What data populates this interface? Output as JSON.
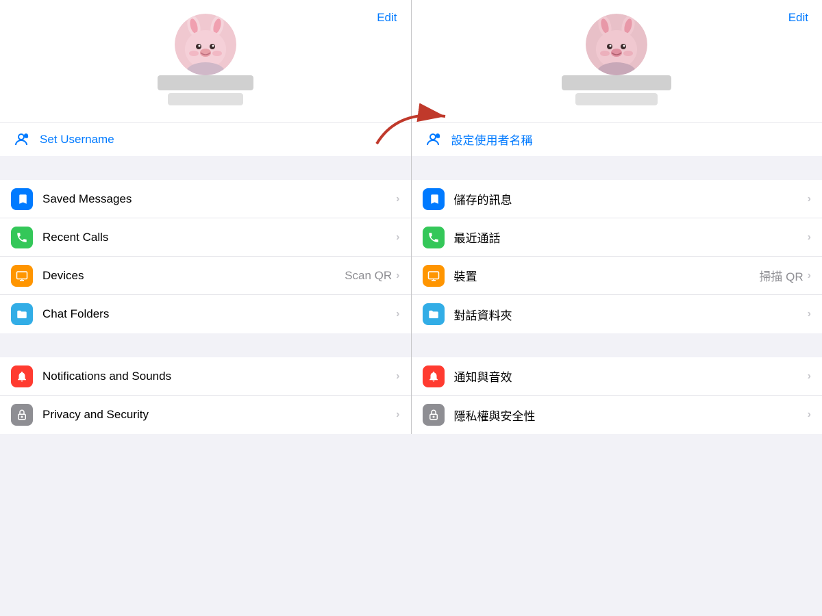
{
  "left": {
    "edit_label": "Edit",
    "username_label": "Set Username",
    "menu_groups": [
      {
        "items": [
          {
            "id": "saved-messages",
            "label": "Saved Messages",
            "icon": "bookmark",
            "icon_color": "icon-blue"
          },
          {
            "id": "recent-calls",
            "label": "Recent Calls",
            "icon": "phone",
            "icon_color": "icon-green"
          },
          {
            "id": "devices",
            "label": "Devices",
            "secondary": "Scan QR",
            "icon": "monitor",
            "icon_color": "icon-orange"
          },
          {
            "id": "chat-folders",
            "label": "Chat Folders",
            "icon": "folder",
            "icon_color": "icon-cyan"
          }
        ]
      },
      {
        "items": [
          {
            "id": "notifications",
            "label": "Notifications and Sounds",
            "icon": "bell",
            "icon_color": "icon-red"
          },
          {
            "id": "privacy",
            "label": "Privacy and Security",
            "icon": "lock",
            "icon_color": "icon-gray"
          }
        ]
      }
    ]
  },
  "right": {
    "edit_label": "Edit",
    "username_label": "設定使用者名稱",
    "menu_groups": [
      {
        "items": [
          {
            "id": "saved-messages-zh",
            "label": "儲存的訊息",
            "icon": "bookmark",
            "icon_color": "icon-blue"
          },
          {
            "id": "recent-calls-zh",
            "label": "最近通話",
            "icon": "phone",
            "icon_color": "icon-green"
          },
          {
            "id": "devices-zh",
            "label": "裝置",
            "secondary": "掃描 QR",
            "icon": "monitor",
            "icon_color": "icon-orange"
          },
          {
            "id": "chat-folders-zh",
            "label": "對話資料夾",
            "icon": "folder",
            "icon_color": "icon-cyan"
          }
        ]
      },
      {
        "items": [
          {
            "id": "notifications-zh",
            "label": "通知與音效",
            "icon": "bell",
            "icon_color": "icon-red"
          },
          {
            "id": "privacy-zh",
            "label": "隱私權與安全性",
            "icon": "lock",
            "icon_color": "icon-gray"
          }
        ]
      }
    ]
  }
}
